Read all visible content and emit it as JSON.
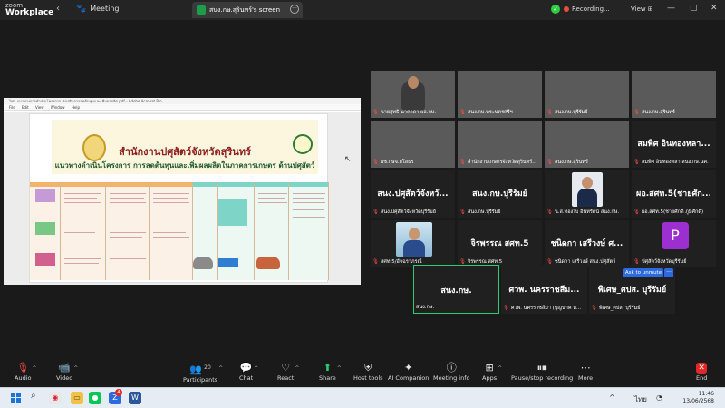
{
  "app": {
    "logo_line1": "zoom",
    "logo_line2": "Workplace"
  },
  "topbar": {
    "meeting_tab": "Meeting",
    "share_tab": "สนง.กษ.สุรินทร์'s screen",
    "recording": "Recording...",
    "view": "View"
  },
  "viewer": {
    "title": "ไฟล์ แนวทางการดำเนินโครงการ ส่งเสริมการลดต้นทุนและเพิ่มผลผลิต.pdf - Adobe Acrobat Pro",
    "menu": [
      "File",
      "Edit",
      "View",
      "Window",
      "Help"
    ]
  },
  "slide": {
    "title1": "สำนักงานปศุสัตว์จังหวัดสุรินทร์",
    "title2": "แนวทางดำเนินโครงการ การลดต้นทุนและเพิ่มผลผลิตในภาคการเกษตร ด้านปศุสัตว์",
    "cursor": "↖"
  },
  "gallery": {
    "tiles": [
      {
        "caption": "นายสุทธิ นาคาดา ผอ.กษ.",
        "muted": true,
        "kind": "video"
      },
      {
        "caption": "สนง.กษ.พระนครศรีฯ",
        "muted": true,
        "kind": "video"
      },
      {
        "caption": "สนง.กษ.บุรีรัมย์",
        "muted": true,
        "kind": "video"
      },
      {
        "caption": "สนง.กษ.สุรินทร์",
        "muted": true,
        "kind": "video"
      },
      {
        "caption": "ผช.กษจ.ยโสธร",
        "muted": true,
        "kind": "video"
      },
      {
        "caption": "สำนักงานเกษตรจังหวัดสุรินทร์...",
        "muted": true,
        "kind": "video"
      },
      {
        "caption": "สนง.กษ.สุรินทร์",
        "muted": true,
        "kind": "video"
      },
      {
        "name": "สมพิศ อินทองหลา...",
        "caption": "สมพิศ อินทองหลา สนง.กษ.นค.",
        "muted": true,
        "kind": "name"
      },
      {
        "name": "สนง.ปศุสัตว์จังหวั...",
        "caption": "สนง.ปศุสัตว์จังหวัดบุรีรัมย์",
        "muted": true,
        "kind": "name"
      },
      {
        "name": "สนง.กษ.บุรีรัมย์",
        "caption": "สนง.กษ.บุรีรัมย์",
        "muted": true,
        "kind": "name"
      },
      {
        "caption": "น.ส.ทองใบ อินทรัตน์ สนง.กษ.",
        "muted": true,
        "kind": "photo-man"
      },
      {
        "name": "ผอ.สศท.5(ชายศัก...",
        "caption": "ผอ.สศท.5(ชายศักดิ์ ภูมิศักดิ์)",
        "muted": true,
        "kind": "name"
      },
      {
        "caption": "สศท.5/อัจฉราภรณ์",
        "muted": true,
        "kind": "photo-lady"
      },
      {
        "name": "จิรพรรณ สศท.5",
        "caption": "จิรพรรณ สศท.5",
        "muted": true,
        "kind": "name"
      },
      {
        "name": "ชนิดกา เสรีวงษ์ ศ...",
        "caption": "ชนิดกา เสรีวงษ์ สนง.ปศุสัตว์",
        "muted": true,
        "kind": "name"
      },
      {
        "avatar": "P",
        "caption": "ปศุสัตว์จังหวัดบุรีรัมย์",
        "muted": true,
        "kind": "avatar"
      }
    ],
    "bottom": [
      {
        "name": "สนง.กษ.",
        "caption": "สนง.กษ.",
        "muted": false,
        "active": true
      },
      {
        "name": "ศวพ. นครราชสีม...",
        "caption": "ศวพ. นครราชสีมา (บุญนาค ห...",
        "muted": true,
        "active": false
      },
      {
        "name": "พิเศษ_ศปส. บุรีรัมย์",
        "caption": "พิเศษ_ศปส. บุรีรัมย์",
        "muted": true,
        "active": false
      }
    ],
    "ask_to_unmute": "Ask to unmute"
  },
  "toolbar": {
    "audio": "Audio",
    "video": "Video",
    "participants": "Participants",
    "participants_count": "20",
    "chat": "Chat",
    "react": "React",
    "share": "Share",
    "host_tools": "Host tools",
    "ai_companion": "AI Companion",
    "meeting_info": "Meeting info",
    "apps": "Apps",
    "pause_recording": "Pause/stop recording",
    "more": "More",
    "end": "End"
  },
  "taskbar": {
    "lang": "ไทย",
    "time": "11:46",
    "date": "13/06/2568",
    "zoom_badge": "4"
  },
  "colors": {
    "accent_blue": "#2d6ae0",
    "green_active": "#2ecc71",
    "mute_red": "#ff4d4d",
    "end_red": "#e02828"
  }
}
